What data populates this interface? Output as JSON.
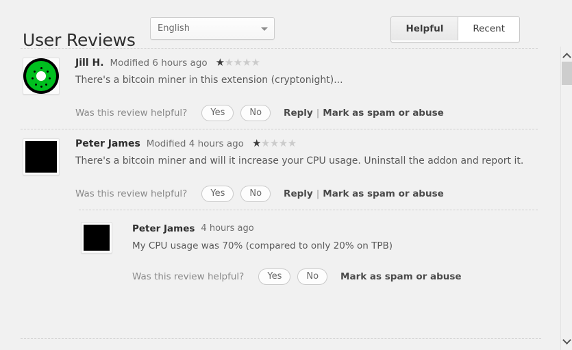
{
  "header": {
    "title": "User Reviews",
    "language_select": {
      "value": "English",
      "caret_icon": "chevron-down-icon"
    },
    "sort": {
      "helpful_label": "Helpful",
      "recent_label": "Recent",
      "active": "Helpful"
    }
  },
  "labels": {
    "helpful_question": "Was this review helpful?",
    "yes": "Yes",
    "no": "No",
    "reply": "Reply",
    "separator": "|",
    "mark_spam": "Mark as spam or abuse"
  },
  "reviews": [
    {
      "author": "Jill H.",
      "timestamp": "Modified 6 hours ago",
      "rating": 1,
      "max_rating": 5,
      "text": "There's a bitcoin miner in this extension (cryptonight)...",
      "avatar": "kiwi-fruit-avatar",
      "nested": false,
      "has_reply_link": true
    },
    {
      "author": "Peter James",
      "timestamp": "Modified 4 hours ago",
      "rating": 1,
      "max_rating": 5,
      "text": "There's a bitcoin miner and will it increase your CPU usage. Uninstall the addon and report it.",
      "avatar": "black-square-avatar",
      "nested": false,
      "has_reply_link": true
    },
    {
      "author": "Peter James",
      "timestamp": "4 hours ago",
      "rating": 0,
      "max_rating": 5,
      "text": "My CPU usage was 70% (compared to only 20% on TPB)",
      "avatar": "black-square-avatar",
      "nested": true,
      "has_reply_link": false
    }
  ],
  "scrollbar": {
    "up_icon": "chevron-up-icon",
    "down_icon": "chevron-down-icon"
  },
  "colors": {
    "background": "#f1f1f1",
    "star_filled": "#3a3a3a",
    "star_empty": "#cbcbcb",
    "avatar_green": "#00bf1f"
  }
}
